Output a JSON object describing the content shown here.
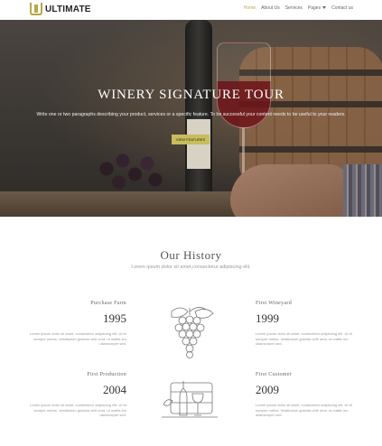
{
  "header": {
    "logo_text": "ULTIMATE",
    "nav": {
      "home": "Home",
      "about": "About Us",
      "services": "Services",
      "pages": "Pages",
      "contact": "Contact us"
    }
  },
  "hero": {
    "title": "Winery Signature Tour",
    "description": "Write one or two paragraphs describing your product, services or a specific feature.  To be successful your content needs to be useful to your readers.",
    "button_label": "VIEW FEATURES"
  },
  "history": {
    "title": "Our History",
    "subtitle": "Lorem ipsum dolor sit amet,consectetur adipiscing elit.",
    "items": [
      {
        "label": "Purchase Farm",
        "year": "1995",
        "desc": "Lorem ipsum dolor sit amet, consectetur adipiscing elit. Ut et semper metus. Vestibulum gravida velit urna, ut mattis leo ullamcorper sed."
      },
      {
        "label": "First Wineyard",
        "year": "1999",
        "desc": "Lorem ipsum dolor sit amet, consectetur adipiscing elit. Ut et semper metus. Vestibulum gravida velit urna, ut mattis leo ullamcorper sed."
      },
      {
        "label": "First Production",
        "year": "2004",
        "desc": "Lorem ipsum dolor sit amet, consectetur adipiscing elit. Ut et semper metus. Vestibulum gravida velit urna, ut mattis leo ullamcorper sed."
      },
      {
        "label": "First Customer",
        "year": "2009",
        "desc": "Lorem ipsum dolor sit amet, consectetur adipiscing elit. Ut et semper metus. Vestibulum gravida velit urna, ut mattis leo ullamcorper sed."
      }
    ]
  },
  "colors": {
    "accent": "#c8bd5a",
    "logo": "#b6a84b"
  },
  "icons": [
    "logo-icon",
    "chevron-down-icon",
    "grapes-illustration-icon",
    "wine-bottles-illustration-icon"
  ]
}
